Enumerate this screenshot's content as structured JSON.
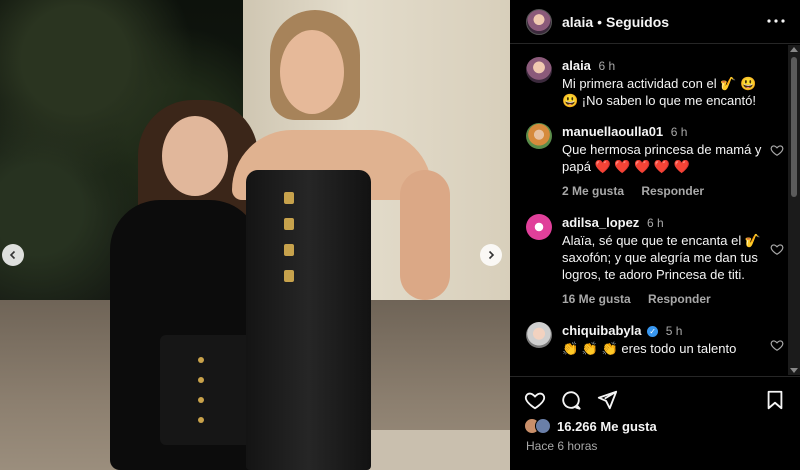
{
  "post": {
    "username": "alaia",
    "dot": "•",
    "follow_status": "Seguidos"
  },
  "comments": [
    {
      "user": "alaia",
      "time": "6 h",
      "text": "Mi primera actividad con el 🎷 😃 😃 ¡No saben lo que me encantó!",
      "likes": "",
      "reply": ""
    },
    {
      "user": "manuellaoulla01",
      "time": "6 h",
      "text": "Que hermosa princesa de mamá y papá ❤️ ❤️ ❤️ ❤️ ❤️",
      "likes": "2 Me gusta",
      "reply": "Responder"
    },
    {
      "user": "adilsa_lopez",
      "time": "6 h",
      "text": "Alaïa, sé que que te encanta el 🎷 saxofón; y que alegría me dan tus logros, te adoro Princesa de titi.",
      "likes": "16 Me gusta",
      "reply": "Responder"
    },
    {
      "user": "chiquibabyla",
      "time": "5 h",
      "text": "👏 👏 👏 eres todo un talento",
      "likes": "",
      "reply": ""
    }
  ],
  "footer": {
    "likes_count": "16.266 Me gusta",
    "time_ago": "Hace 6 horas"
  },
  "icons": {
    "more": "more-icon",
    "like": "heart-icon",
    "comment": "comment-icon",
    "share": "share-icon",
    "save": "bookmark-icon",
    "prev": "chevron-left-icon",
    "next": "chevron-right-icon"
  }
}
